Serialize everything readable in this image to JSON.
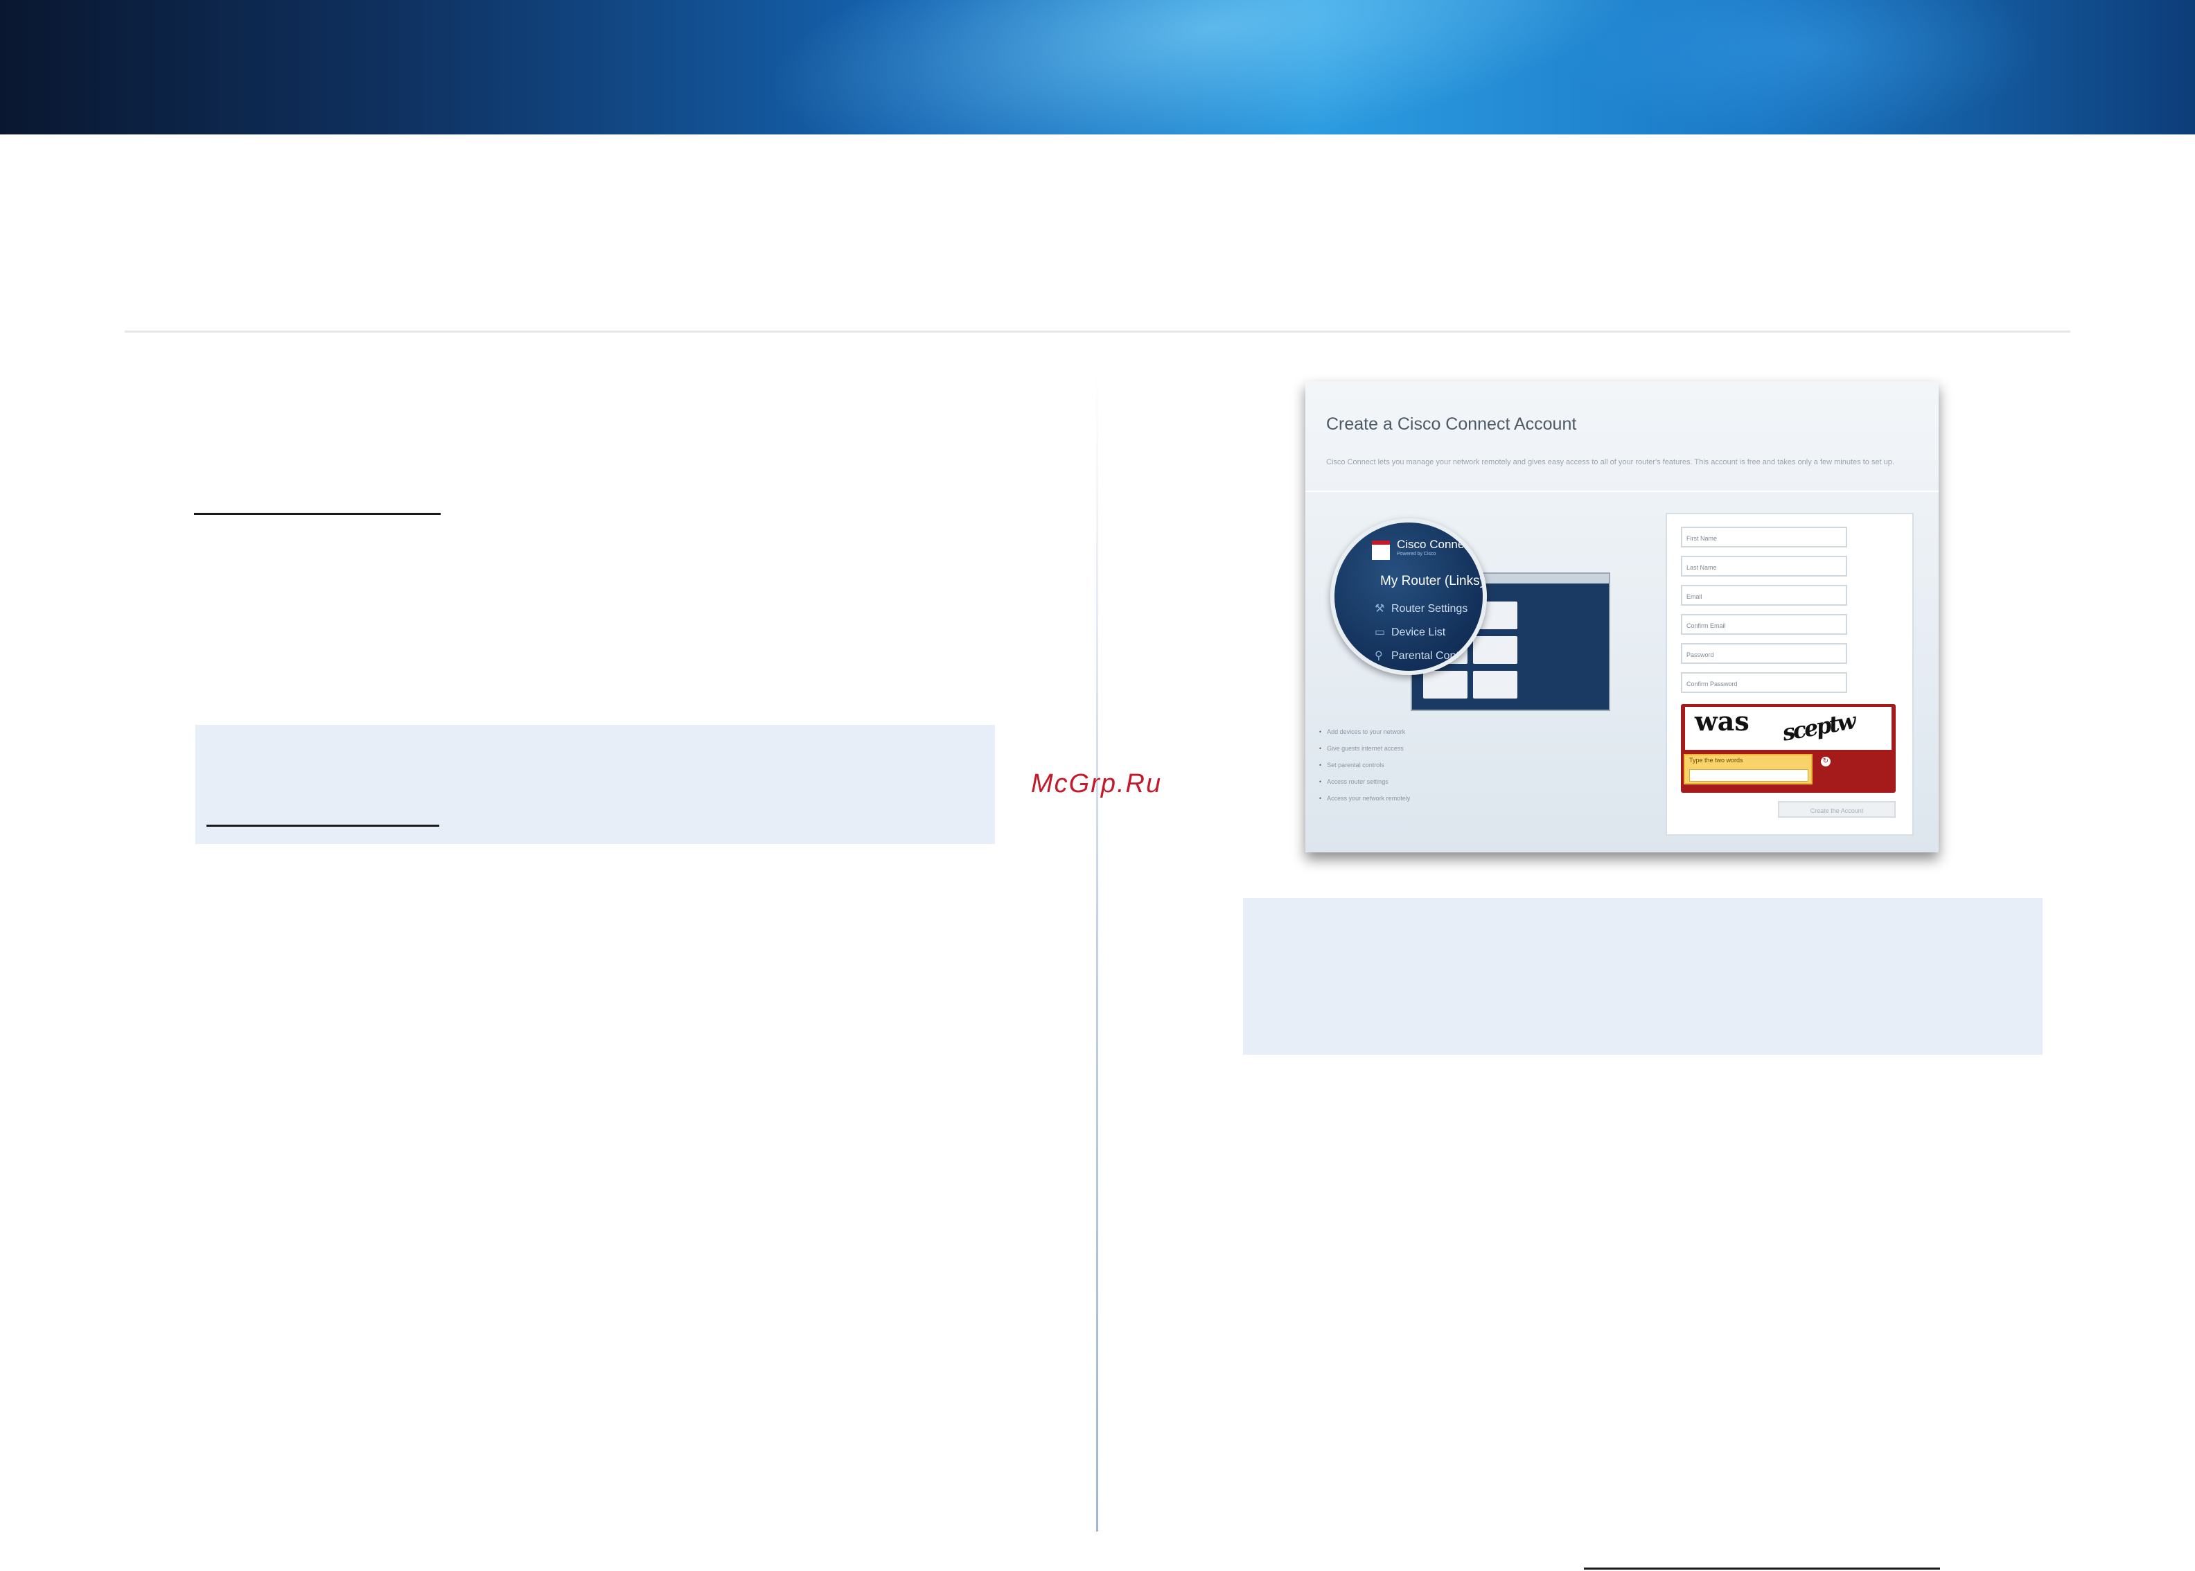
{
  "watermark": "McGrp.Ru",
  "screenshot": {
    "title": "Create a Cisco Connect Account",
    "description": "Cisco Connect lets you manage your network remotely and gives easy access to all of your router's features. This account is free and takes only a few minutes to set up.",
    "product": {
      "brand": "Cisco Connect",
      "tagline": "Powered by Cisco",
      "router_label": "My Router (Linksys)",
      "menu": [
        {
          "label": "Router Settings",
          "icon": "wrench-icon"
        },
        {
          "label": "Device List",
          "icon": "monitor-icon"
        },
        {
          "label": "Parental Controls",
          "icon": "person-icon"
        }
      ]
    },
    "features": [
      "Add devices to your network",
      "Give guests internet access",
      "Set parental controls",
      "Access router settings",
      "Access your network remotely"
    ],
    "form": {
      "fields": [
        "First Name",
        "Last Name",
        "Email",
        "Confirm Email",
        "Password",
        "Confirm Password"
      ],
      "captcha": {
        "word1": "was",
        "word2": "sceptw",
        "hint": "Type the two words"
      },
      "submit_label": "Create the Account"
    }
  },
  "colors": {
    "banner_dark": "#0a1730",
    "banner_light": "#2b9be0",
    "note_background": "#e8eef8",
    "captcha_red": "#a51a1a",
    "watermark": "#c4182b"
  }
}
